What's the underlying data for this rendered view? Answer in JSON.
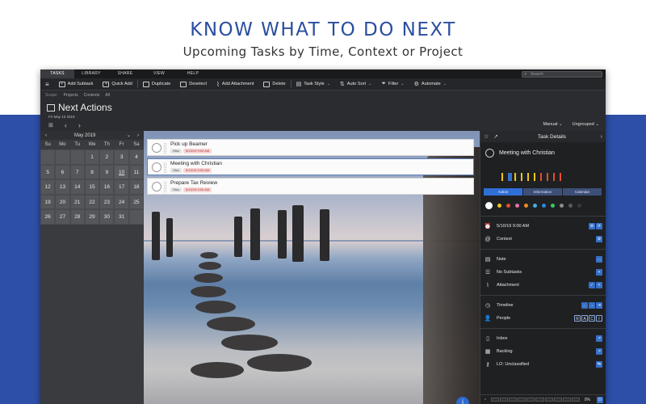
{
  "promo": {
    "title": "KNOW WHAT TO DO NEXT",
    "subtitle": "Upcoming Tasks by Time, Context or Project"
  },
  "menubar": {
    "tabs": [
      "TASKS",
      "LIBRARY",
      "SHARE",
      "VIEW",
      "HELP"
    ],
    "active_tab": "TASKS",
    "search_placeholder": "Search"
  },
  "toolbar": {
    "menu_icon": "hamburger-icon",
    "add_subtask": "Add Subtask",
    "quick_add": "Quick Add",
    "duplicate": "Duplicate",
    "deselect": "Deselect",
    "add_attachment": "Add Attachment",
    "delete": "Delete",
    "task_style": "Task Style",
    "auto_sort": "Auto Sort",
    "filter": "Filter",
    "automate": "Automate"
  },
  "scope": {
    "label": "Scope:",
    "items": [
      "Projects",
      "Contexts",
      "All"
    ]
  },
  "view": {
    "title": "Next Actions",
    "date": "Fri May 10 2019",
    "sort_mode": "Manual",
    "group_mode": "Ungrouped"
  },
  "calendar": {
    "month_label": "May 2019",
    "weekdays": [
      "Su",
      "Mo",
      "Tu",
      "We",
      "Th",
      "Fr",
      "Sa"
    ],
    "weeks": [
      [
        "",
        "",
        "",
        "1",
        "2",
        "3",
        "4"
      ],
      [
        "5",
        "6",
        "7",
        "8",
        "9",
        "10",
        "11"
      ],
      [
        "12",
        "13",
        "14",
        "15",
        "16",
        "17",
        "18"
      ],
      [
        "19",
        "20",
        "21",
        "22",
        "23",
        "24",
        "25"
      ],
      [
        "26",
        "27",
        "28",
        "29",
        "30",
        "31",
        ""
      ]
    ],
    "today": "10"
  },
  "tasks": [
    {
      "title": "Pick up Beamer",
      "context": "Hiox",
      "date": "5/10/19 9:00 AM",
      "selected": false
    },
    {
      "title": "Meeting with Christian",
      "context": "Hiox",
      "date": "5/10/19 9:00 AM",
      "selected": true
    },
    {
      "title": "Prepare Tax Review",
      "context": "Hiox",
      "date": "5/10/19 9:00 AM",
      "selected": false
    }
  ],
  "detail": {
    "header": "Task Details",
    "task_title": "Meeting with Christian",
    "segments": [
      "Action",
      "Information",
      "Calendar"
    ],
    "active_segment": "Action",
    "priority_colors": [
      "#f0c419",
      "#3670c9",
      "#f0c419",
      "#f0c419",
      "#f0c419",
      "#f0c419",
      "#e34d2f",
      "#e34d2f",
      "#e34d2f",
      "#e34d2f"
    ],
    "label_colors": [
      "#ffffff",
      "#f0c419",
      "#e34d2f",
      "#e46cb2",
      "#f08a24",
      "#3eb0e8",
      "#2e86de",
      "#3ec46d",
      "#8c8c8c",
      "#5a5a5a",
      "#3a3a3a"
    ],
    "rows": {
      "due": "5/10/19 9:00 AM",
      "context": "Context",
      "note": "Note",
      "subtasks": "No Subtasks",
      "attachment": "Attachment",
      "timeline": "Timeline",
      "people": "People",
      "inbox": "Inbox",
      "backlog": "Backlog",
      "lo": "LO: Unclassified"
    },
    "progress": "0%"
  }
}
